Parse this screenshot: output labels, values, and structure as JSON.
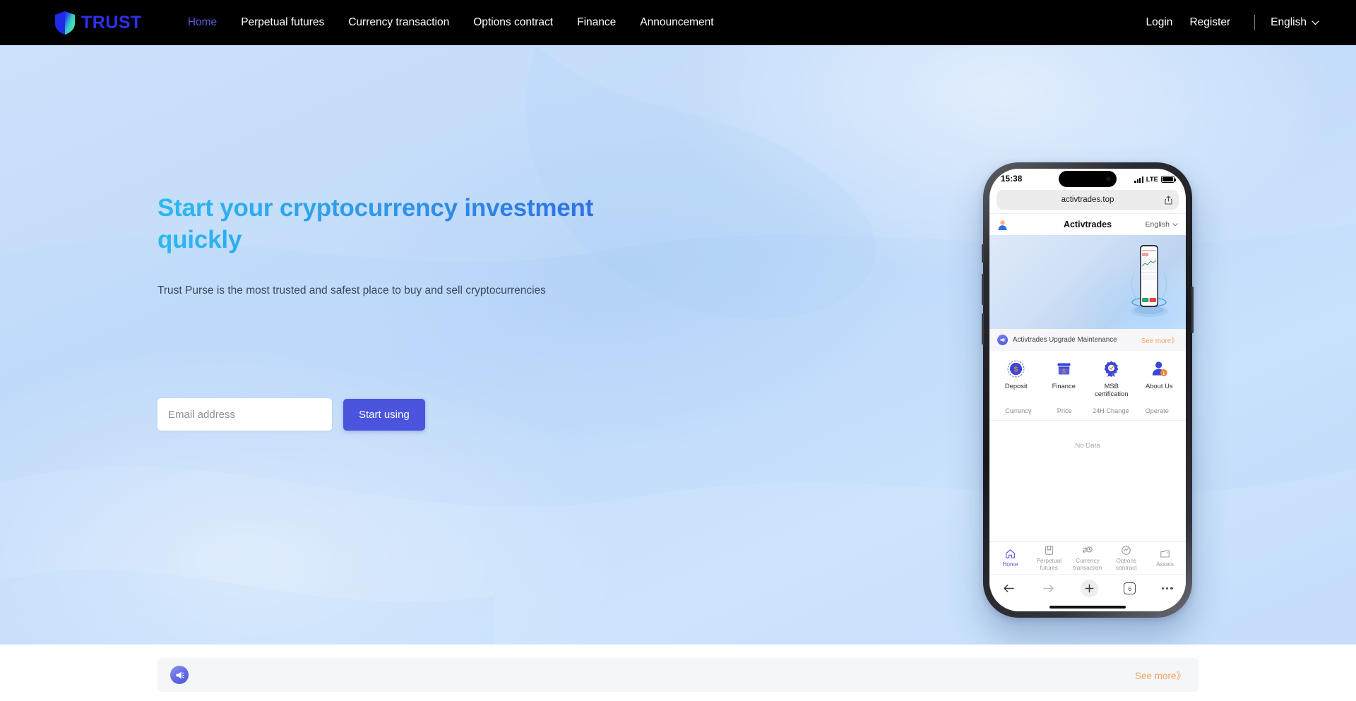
{
  "nav": {
    "brand": {
      "name": "TRUST",
      "icon": "shield-icon",
      "color": "#2f2ff0"
    },
    "links": [
      {
        "label": "Home",
        "active": true
      },
      {
        "label": "Perpetual futures",
        "active": false
      },
      {
        "label": "Currency transaction",
        "active": false
      },
      {
        "label": "Options contract",
        "active": false
      },
      {
        "label": "Finance",
        "active": false
      },
      {
        "label": "Announcement",
        "active": false
      }
    ],
    "login_label": "Login",
    "register_label": "Register",
    "language": "English"
  },
  "hero": {
    "title": "Start your cryptocurrency investment quickly",
    "subtitle": "Trust Purse is the most trusted and safest place to buy and sell cryptocurrencies",
    "email_placeholder": "Email address",
    "email_value": "",
    "cta_label": "Start using",
    "cta_color": "#4a54dd",
    "title_gradient_from": "#2bb9ef",
    "title_gradient_to": "#2f6fe4",
    "background_color": "#c2ddfa"
  },
  "phone": {
    "status": {
      "time": "15:38",
      "network": "LTE"
    },
    "browser": {
      "url": "activtrades.top",
      "tab_count": "6"
    },
    "app": {
      "title": "Activtrades",
      "language": "English"
    },
    "notice": {
      "text": "Activtrades Upgrade Maintenance",
      "more_label": "See more》",
      "more_color": "#f0a35a"
    },
    "quick_actions": [
      {
        "label": "Deposit",
        "icon": "coin-dollar-icon"
      },
      {
        "label": "Finance",
        "icon": "bank-icon"
      },
      {
        "label": "MSB certification",
        "icon": "badge-check-icon"
      },
      {
        "label": "About Us",
        "icon": "user-info-icon"
      }
    ],
    "market": {
      "columns": [
        "Currency",
        "Price",
        "24H Change",
        "Operate"
      ],
      "empty_text": "No Data"
    },
    "tabs": [
      {
        "label": "Home",
        "icon": "home-icon",
        "active": true
      },
      {
        "label": "Perpetual futures",
        "icon": "book-icon",
        "active": false
      },
      {
        "label": "Currency transaction",
        "icon": "exchange-clock-icon",
        "active": false
      },
      {
        "label": "Options contract",
        "icon": "chart-circle-icon",
        "active": false
      },
      {
        "label": "Assets",
        "icon": "wallet-icon",
        "active": false
      }
    ],
    "active_tab_color": "#5b5ce0"
  },
  "announcement": {
    "icon": "megaphone-icon",
    "text": "",
    "more_label": "See more》",
    "more_color": "#efa463"
  }
}
